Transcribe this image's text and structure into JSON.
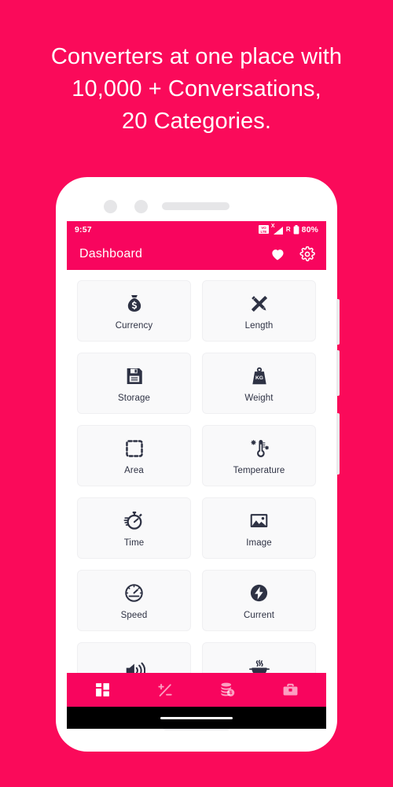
{
  "promo": {
    "lines": [
      "Converters at one place with",
      "10,000 + Conversations,",
      "20 Categories."
    ],
    "background_color": "#fa0a5a",
    "text_color": "#ffffff"
  },
  "phone": {
    "sensor_left": "proximity-sensor",
    "sensor_right": "front-camera",
    "earpiece": "earpiece-speaker",
    "bottom_speaker": "bottom-speaker-grill"
  },
  "status_bar": {
    "time": "9:57",
    "volte_line1": "VO",
    "volte_line2": "LTE",
    "signal_x": "X",
    "roaming": "R",
    "battery": "80%",
    "background_color": "#f8055e"
  },
  "app_bar": {
    "title": "Dashboard",
    "favorite_icon": "heart-icon",
    "settings_icon": "gear-icon",
    "background_color": "#f8055e"
  },
  "converters": [
    {
      "label": "Currency",
      "icon": "money-bag-icon"
    },
    {
      "label": "Length",
      "icon": "ruler-pencil-icon"
    },
    {
      "label": "Storage",
      "icon": "floppy-disk-icon"
    },
    {
      "label": "Weight",
      "icon": "kg-weight-icon",
      "icon_text": "KG"
    },
    {
      "label": "Area",
      "icon": "dashed-square-icon"
    },
    {
      "label": "Temperature",
      "icon": "thermometer-snowflake-icon"
    },
    {
      "label": "Time",
      "icon": "stopwatch-icon"
    },
    {
      "label": "Image",
      "icon": "picture-icon"
    },
    {
      "label": "Speed",
      "icon": "speedometer-icon"
    },
    {
      "label": "Current",
      "icon": "lightning-bolt-icon"
    },
    {
      "label": "",
      "icon": "speaker-volume-icon"
    },
    {
      "label": "",
      "icon": "bbq-grill-icon"
    }
  ],
  "bottom_nav": [
    {
      "name": "dashboard",
      "icon": "grid-icon",
      "active": true
    },
    {
      "name": "calculator",
      "icon": "plus-minus-icon",
      "active": false
    },
    {
      "name": "money",
      "icon": "coins-icon",
      "active": false
    },
    {
      "name": "tools",
      "icon": "toolbox-icon",
      "active": false
    }
  ],
  "colors": {
    "brand_pink": "#f8055e",
    "page_pink": "#fa0a5a",
    "icon_dark": "#2e3244",
    "card_bg": "#f9f9fa"
  }
}
